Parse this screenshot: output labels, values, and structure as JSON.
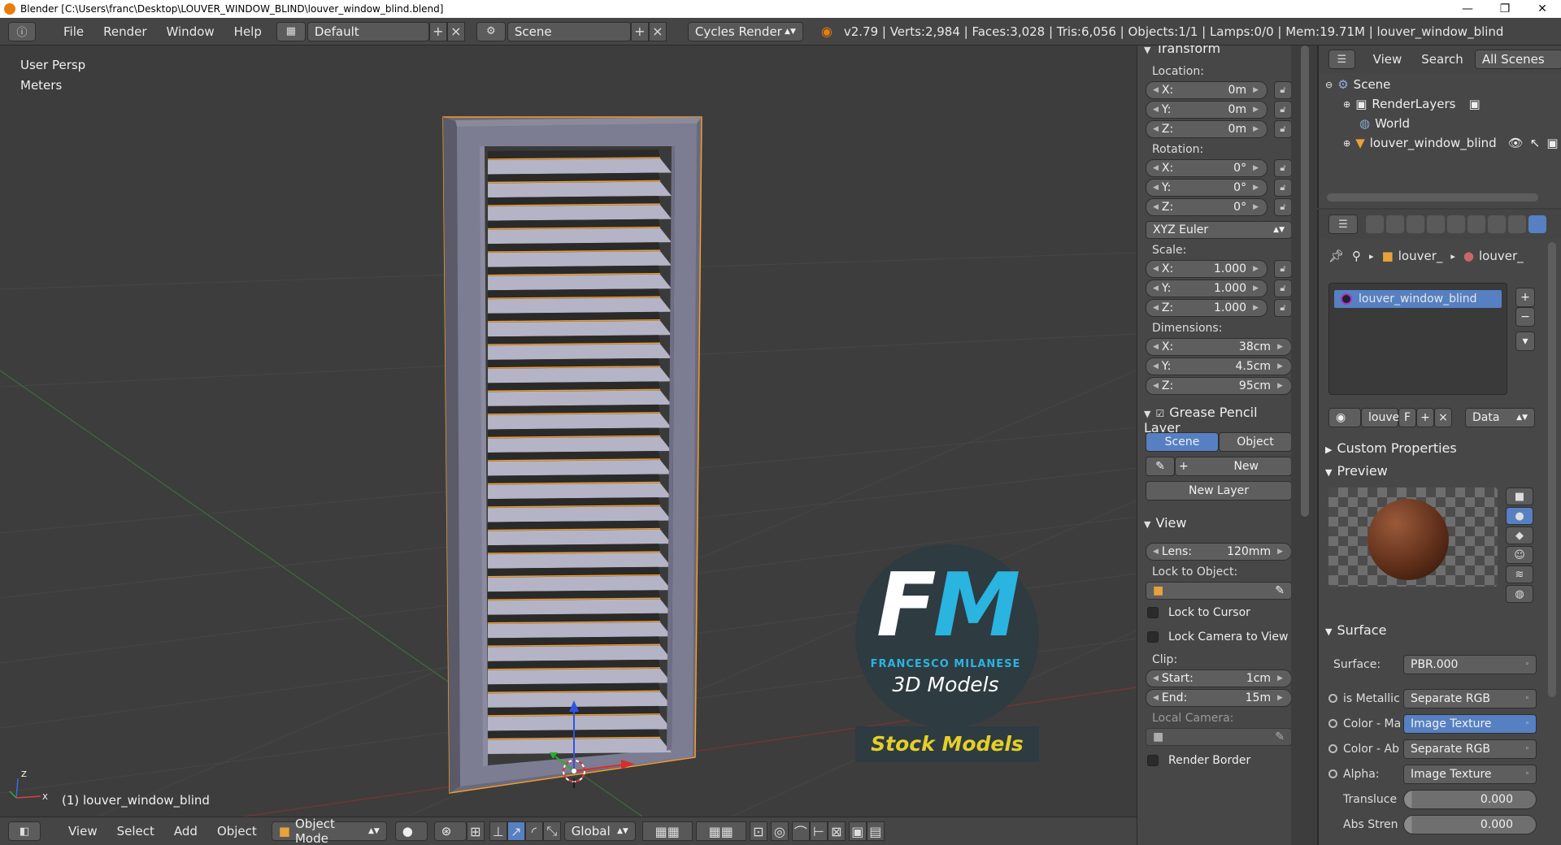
{
  "title_bar": {
    "title": "Blender [C:\\Users\\franc\\Desktop\\LOUVER_WINDOW_BLIND\\louver_window_blind.blend]",
    "min_glyph": "—",
    "max_glyph": "❐",
    "close_glyph": "✕"
  },
  "info_header": {
    "menus": [
      "File",
      "Render",
      "Window",
      "Help"
    ],
    "screen_layout": "Default",
    "scene": "Scene",
    "render_engine": "Cycles Render",
    "stats": "v2.79 | Verts:2,984 | Faces:3,028 | Tris:6,056 | Objects:1/1 | Lamps:0/0 | Mem:19.71M | louver_window_blind"
  },
  "viewport": {
    "view_name": "User Persp",
    "units": "Meters",
    "object_label": "(1) louver_window_blind",
    "axis_z": "Z",
    "axis_x": "X",
    "slat_count": 26
  },
  "watermark": {
    "logo_letter_f": "F",
    "logo_letter_m": "M",
    "name": "FRANCESCO MILANESE",
    "subtitle": "3D Models",
    "banner": "Stock Models"
  },
  "viewport_header": {
    "menus": [
      "View",
      "Select",
      "Add",
      "Object"
    ],
    "mode": "Object Mode",
    "orientation": "Global"
  },
  "n_panel": {
    "transform": {
      "title": "Transform",
      "location_label": "Location:",
      "location": [
        {
          "axis": "X:",
          "value": "0m"
        },
        {
          "axis": "Y:",
          "value": "0m"
        },
        {
          "axis": "Z:",
          "value": "0m"
        }
      ],
      "rotation_label": "Rotation:",
      "rotation": [
        {
          "axis": "X:",
          "value": "0°"
        },
        {
          "axis": "Y:",
          "value": "0°"
        },
        {
          "axis": "Z:",
          "value": "0°"
        }
      ],
      "rotation_mode": "XYZ Euler",
      "scale_label": "Scale:",
      "scale": [
        {
          "axis": "X:",
          "value": "1.000"
        },
        {
          "axis": "Y:",
          "value": "1.000"
        },
        {
          "axis": "Z:",
          "value": "1.000"
        }
      ],
      "dimensions_label": "Dimensions:",
      "dimensions": [
        {
          "axis": "X:",
          "value": "38cm"
        },
        {
          "axis": "Y:",
          "value": "4.5cm"
        },
        {
          "axis": "Z:",
          "value": "95cm"
        }
      ]
    },
    "grease_pencil": {
      "title": "Grease Pencil Layer",
      "scene_btn": "Scene",
      "object_btn": "Object",
      "new_btn": "New",
      "new_layer_btn": "New Layer"
    },
    "view": {
      "title": "View",
      "lens": {
        "label": "Lens:",
        "value": "120mm"
      },
      "lock_to_object": "Lock to Object:",
      "lock_to_cursor": "Lock to Cursor",
      "lock_camera": "Lock Camera to View",
      "clip_label": "Clip:",
      "clip_start": {
        "label": "Start:",
        "value": "1cm"
      },
      "clip_end": {
        "label": "End:",
        "value": "15m"
      },
      "local_camera": "Local Camera:",
      "render_border": "Render Border"
    }
  },
  "outliner": {
    "view_menu": "View",
    "search_menu": "Search",
    "filter": "All Scenes",
    "items": [
      {
        "label": "Scene"
      },
      {
        "label": "RenderLayers"
      },
      {
        "label": "World"
      },
      {
        "label": "louver_window_blind"
      }
    ]
  },
  "properties": {
    "breadcrumb": [
      "louver_",
      "louver_"
    ],
    "material_slot": "louver_window_blind",
    "material_name_short": "louve",
    "fake_user": "F",
    "link_type": "Data",
    "custom_properties": "Custom Properties",
    "preview": "Preview",
    "surface_section": "Surface",
    "surface": {
      "label": "Surface:",
      "value": "PBR.000"
    },
    "inputs": [
      {
        "label": "is Metallic",
        "value": "Separate RGB"
      },
      {
        "label": "Color - Ma",
        "value": "Image Texture"
      },
      {
        "label": "Color - Ab",
        "value": "Separate RGB"
      },
      {
        "label": "Alpha:",
        "value": "Image Texture"
      }
    ],
    "sliders": [
      {
        "label": "Transluce",
        "value": "0.000"
      },
      {
        "label": "Abs Stren",
        "value": "0.000"
      }
    ]
  },
  "colors": {
    "accent_blue": "#5680c2",
    "selection_orange": "#f29d2c",
    "watermark_cyan": "#2ab4e0",
    "watermark_yellow": "#e5cf29"
  }
}
